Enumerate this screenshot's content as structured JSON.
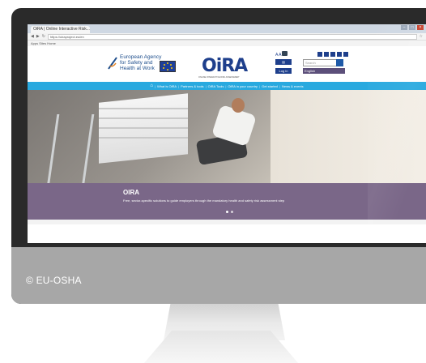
{
  "browser": {
    "tab_title": "OiRA | Online Interactive Risk...",
    "url": "https://oiraproject.eu/en",
    "bookmarks": "Apps  Sites  Home"
  },
  "site": {
    "agency_name": "European Agency for Safety and Health at Work",
    "logo_text": "OiRA",
    "tagline": "ONLINE INTERACTIVE RISK ASSESSMENT",
    "search_placeholder": "Search",
    "login_label": "Log in",
    "language": "English",
    "tools_label": "A A",
    "nav": [
      "Home",
      "What is OiRA",
      "Partners & tools",
      "OiRA Tools",
      "OiRA in your country",
      "Get started",
      "News & events"
    ]
  },
  "hero": {
    "title": "OIRA",
    "text": "Free, sector-specific solutions to guide employers through the mandatory health and safety risk assessment step"
  },
  "monitor": {
    "copyright": "© EU-OSHA"
  }
}
